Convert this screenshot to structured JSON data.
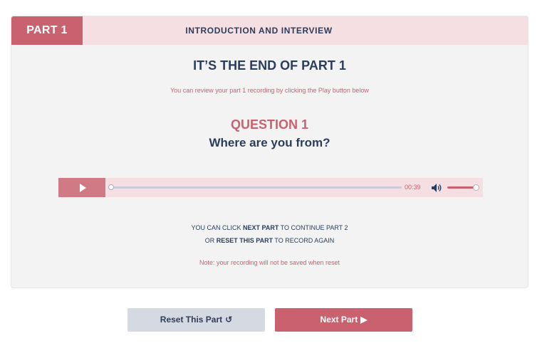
{
  "header": {
    "part_badge": "PART 1",
    "title": "INTRODUCTION AND INTERVIEW"
  },
  "main": {
    "end_title": "IT’S THE END OF PART 1",
    "review_text": "You can review your part 1 recording by clicking the Play button below",
    "question_label": "QUESTION 1",
    "question_text": "Where are you from?"
  },
  "player": {
    "time": "00:39",
    "progress": 0,
    "volume": 1.0
  },
  "instructions": {
    "line1_pre": "YOU CAN CLICK ",
    "line1_bold": "NEXT PART",
    "line1_post": " TO CONTINUE PART 2",
    "line2_pre": "OR ",
    "line2_bold": "RESET THIS PART",
    "line2_post": " TO RECORD AGAIN",
    "note": "Note: your recording will not be saved when reset"
  },
  "buttons": {
    "reset_label": "Reset This Part",
    "reset_icon": "↺",
    "next_label": "Next Part",
    "next_icon": "▶"
  },
  "colors": {
    "accent": "#c9616f",
    "header_bg": "#f5dfe2",
    "navy": "#2b3d5c",
    "reset_bg": "#d5dae2"
  },
  "icons": {
    "play": "play-icon",
    "volume": "volume-icon",
    "reset": "reset-icon",
    "next": "next-arrow-icon"
  }
}
